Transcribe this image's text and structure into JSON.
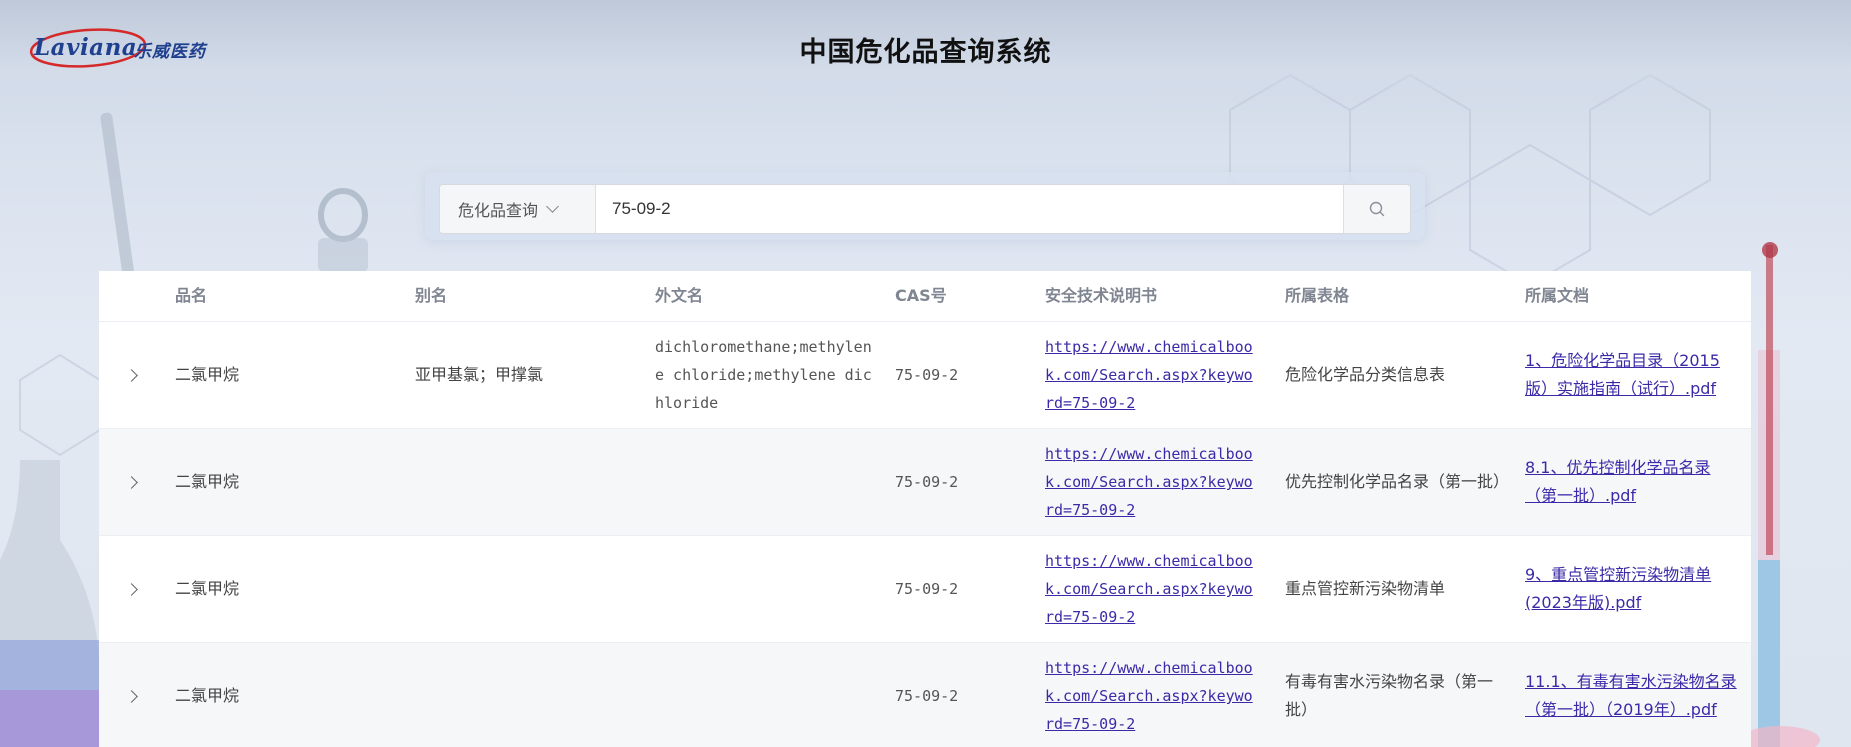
{
  "header": {
    "logo_text": "Laviana",
    "logo_cn": "乐威医药",
    "title": "中国危化品查询系统"
  },
  "search": {
    "category_label": "危化品查询",
    "query": "75-09-2"
  },
  "table": {
    "columns": [
      "品名",
      "别名",
      "外文名",
      "CAS号",
      "安全技术说明书",
      "所属表格",
      "所属文档"
    ],
    "rows": [
      {
        "name": "二氯甲烷",
        "alias": "亚甲基氯；甲撑氯",
        "foreign_name": "dichloromethane;methylene chloride;methylene dichloride",
        "cas": "75-09-2",
        "msds": "https://www.chemicalbook.com/Search.aspx?keyword=75-09-2",
        "table_name": "危险化学品分类信息表",
        "document": "1、危险化学品目录（2015版）实施指南（试行）.pdf"
      },
      {
        "name": "二氯甲烷",
        "alias": "",
        "foreign_name": "",
        "cas": "75-09-2",
        "msds": "https://www.chemicalbook.com/Search.aspx?keyword=75-09-2",
        "table_name": "优先控制化学品名录（第一批）",
        "document": "8.1、优先控制化学品名录（第一批）.pdf"
      },
      {
        "name": "二氯甲烷",
        "alias": "",
        "foreign_name": "",
        "cas": "75-09-2",
        "msds": "https://www.chemicalbook.com/Search.aspx?keyword=75-09-2",
        "table_name": "重点管控新污染物清单",
        "document": "9、重点管控新污染物清单(2023年版).pdf"
      },
      {
        "name": "二氯甲烷",
        "alias": "",
        "foreign_name": "",
        "cas": "75-09-2",
        "msds": "https://www.chemicalbook.com/Search.aspx?keyword=75-09-2",
        "table_name": "有毒有害水污染物名录（第一批）",
        "document": "11.1、有毒有害水污染物名录（第一批）（2019年）.pdf"
      }
    ]
  },
  "colors": {
    "link": "#3b2aa8",
    "header_text": "#7f8692",
    "accent_logo": "#1f3f8f",
    "logo_swoosh": "#d42a2a"
  },
  "icons": {
    "search_button": "search-icon",
    "select_caret": "chevron-down-icon",
    "row_expand": "chevron-right-icon"
  }
}
